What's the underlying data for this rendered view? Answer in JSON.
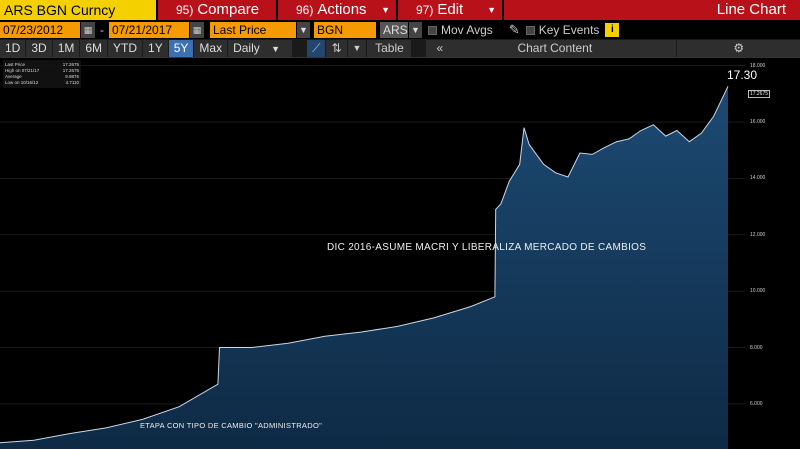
{
  "function_bar": {
    "ticker": "ARS BGN Curncy",
    "buttons": [
      {
        "num": "95)",
        "label": "Compare"
      },
      {
        "num": "96)",
        "label": "Actions"
      },
      {
        "num": "97)",
        "label": "Edit"
      }
    ],
    "chart_title": "Line Chart"
  },
  "toolbar": {
    "start_date": "07/23/2012",
    "end_date": "07/21/2017",
    "field": "Last Price",
    "source": "BGN",
    "currency": "ARS",
    "mov_avgs_label": "Mov Avgs",
    "key_events_label": "Key Events",
    "info_icon": "i"
  },
  "ranges": {
    "tabs": [
      "1D",
      "3D",
      "1M",
      "6M",
      "YTD",
      "1Y",
      "5Y",
      "Max"
    ],
    "active": "5Y",
    "frequency": "Daily",
    "table_label": "Table",
    "chart_content_label": "Chart Content"
  },
  "legend": {
    "rows": [
      {
        "label": "Last Price",
        "value": "17.2675"
      },
      {
        "label": "High on 07/21/17",
        "value": "17.2675"
      },
      {
        "label": "Average",
        "value": "9.9876"
      },
      {
        "label": "Low on 10/16/12",
        "value": "4.7110"
      }
    ]
  },
  "annotations": {
    "macri": "DIC 2016-ASUME MACRI Y LIBERALIZA MERCADO DE CAMBIOS",
    "administrado": "ETAPA CON TIPO DE CAMBIO \"ADMINISTRADO\""
  },
  "last_value_label": "17.30",
  "last_value_box": "17.2675",
  "colors": {
    "ticker_bg": "#f5d000",
    "function_bg": "#b8111a",
    "field_bg": "#f59a00",
    "active_tab": "#3d6fb3",
    "area_fill": "#173a5c",
    "line": "#c8d8e8"
  },
  "chart_data": {
    "type": "area",
    "title": "",
    "xlabel": "",
    "ylabel": "",
    "ylim": [
      4.4,
      18.2
    ],
    "yticks": [
      "18.000",
      "16.000",
      "14.000",
      "12.000",
      "10.000",
      "8.000",
      "6.000"
    ],
    "ytick_values": [
      18,
      16,
      14,
      12,
      10,
      8,
      6
    ],
    "x": [
      "2012-07-23",
      "2012-10-16",
      "2013-01-15",
      "2013-04-15",
      "2013-07-15",
      "2013-10-15",
      "2014-01-20",
      "2014-01-24",
      "2014-04-15",
      "2014-07-15",
      "2014-10-15",
      "2015-01-15",
      "2015-04-15",
      "2015-07-15",
      "2015-10-15",
      "2015-12-15",
      "2015-12-17",
      "2015-12-30",
      "2016-01-20",
      "2016-02-15",
      "2016-02-26",
      "2016-03-10",
      "2016-04-15",
      "2016-05-15",
      "2016-06-15",
      "2016-07-15",
      "2016-08-15",
      "2016-09-15",
      "2016-10-15",
      "2016-11-15",
      "2016-12-15",
      "2017-01-15",
      "2017-02-15",
      "2017-03-15",
      "2017-04-15",
      "2017-05-15",
      "2017-06-15",
      "2017-07-21"
    ],
    "values": [
      4.62,
      4.711,
      4.95,
      5.15,
      5.45,
      5.9,
      6.7,
      8.0,
      8.0,
      8.15,
      8.4,
      8.55,
      8.75,
      9.05,
      9.45,
      9.8,
      12.9,
      13.1,
      13.9,
      14.5,
      15.8,
      15.2,
      14.5,
      14.2,
      14.05,
      14.9,
      14.85,
      15.1,
      15.3,
      15.4,
      15.7,
      15.9,
      15.5,
      15.7,
      15.3,
      15.6,
      16.2,
      17.2675
    ]
  }
}
